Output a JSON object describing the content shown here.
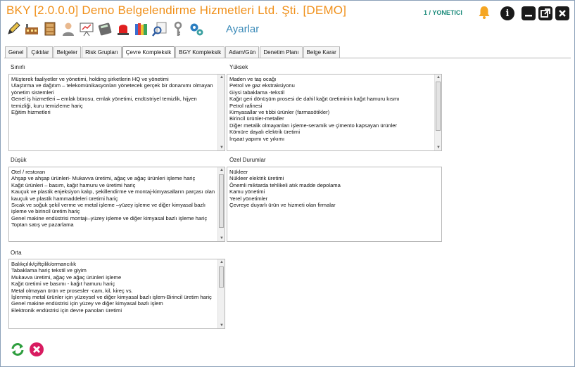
{
  "window": {
    "title": "BKY [2.0.0.0] Demo Belgelendirme Hizmetleri Ltd. Şti. [DEMO]",
    "user": "1 / YONETICI"
  },
  "toolbar": {
    "section_label": "Ayarlar",
    "icons": [
      "pen-icon",
      "factory-icon",
      "cabinet-icon",
      "user-icon",
      "presentation-icon",
      "calculator-icon",
      "alarm-light-icon",
      "books-icon",
      "search-doc-icon",
      "key-icon",
      "gears-icon"
    ]
  },
  "tabs": [
    {
      "label": "Genel"
    },
    {
      "label": "Çıktılar"
    },
    {
      "label": "Belgeler"
    },
    {
      "label": "Risk Grupları"
    },
    {
      "label": "Çevre Kompleksitesi",
      "display": "Çevre Kompleksik",
      "active": true
    },
    {
      "label": "BGY Kompleksik"
    },
    {
      "label": "Adam/Gün"
    },
    {
      "label": "Denetim Planı"
    },
    {
      "label": "Belge Karar"
    }
  ],
  "groups": {
    "sinirli": {
      "label": "Sınırlı",
      "items": [
        "Müşterek faaliyetler ve yönetimi, holding şirketlerin HQ ve yönetimi",
        "Ulaştırma ve dağıtım – telekomünikasyonları yönetecek gerçek bir donanımı olmayan yönetim sistemleri",
        "Genel iş hizmetleri – emlak bürosu, emlak yönetimi, endüstriyel temizlik, hijyen temizliği, kuru temizleme hariç",
        "Eğitim hizmetleri"
      ]
    },
    "yuksek": {
      "label": "Yüksek",
      "items": [
        "Maden ve taş ocağı",
        "Petrol ve gaz ekstraksiyonu",
        "Giysi tabaklama -tekstil",
        "Kağıt geri dönüşüm prosesi de dahil kağıt üretiminin kağıt hamuru kısmı",
        "Petrol rafinesi",
        "Kimyasallar ve tıbbi ürünler  (farmasötikler)",
        "Birincil ürünler-metaller",
        "Diğer metalik olmayanları işleme-seramik ve çimento kapsayan ürünler",
        "Kömüre dayalı elektrik üretimi",
        "İnşaat yapımı ve yıkımı"
      ]
    },
    "dusuk": {
      "label": "Düşük",
      "items": [
        "Otel / restoran",
        "Ahşap ve ahşap ürünleri- Mukavva üretimi, ağaç ve ağaç ürünleri işleme hariç",
        "Kağıt ürünleri – basım, kağıt hamuru ve üretimi hariç",
        "Kauçuk ve plastik enjeksiyon kalıp, şekillendirme ve montaj-kimyasalların parçası olan kauçuk ve plastik hammaddeleri üretimi hariç",
        "Sıcak ve soğuk şekil verme ve metal işleme –yüzey işleme ve diğer kimyasal bazlı işleme ve birincil üretim hariç",
        "Genel makine endüstrisi montajı–yüzey işleme ve diğer kimyasal bazlı işleme hariç",
        "Toptan satış ve pazarlama"
      ]
    },
    "ozel": {
      "label": "Özel Durumlar",
      "items": [
        "Nükleer",
        "Nükleer elektrik üretimi",
        "Önemli miktarda tehlikeli atık madde depolama",
        "Kamu yönetimi",
        "Yerel yönetimler",
        "Çevreye duyarlı ürün ve hizmeti olan firmalar"
      ]
    },
    "orta": {
      "label": "Orta",
      "items": [
        "Balıkçılık/çiftçilik/ormancılık",
        "Tabaklama hariç tekstil ve giyim",
        "Mukavva üretimi, ağaç ve ağaç  ürünleri işleme",
        "Kağıt üretimi ve basımı - kağıt hamuru hariç",
        "Metal olmayan ürün ve prosesler -cam, kil, kireç vs.",
        "İşlenmiş metal ürünler için yüzeysel ve diğer kimyasal bazlı işlem-Birincil üretim hariç",
        "Genel makine endüstrisi için yüzey ve diğer kimyasal bazlı işlem",
        "Elektronik endüstrisi için devre panoları üretimi"
      ]
    }
  },
  "colors": {
    "title": "#f0901a",
    "user": "#1a8a7a",
    "accent": "#3a8ab8"
  }
}
